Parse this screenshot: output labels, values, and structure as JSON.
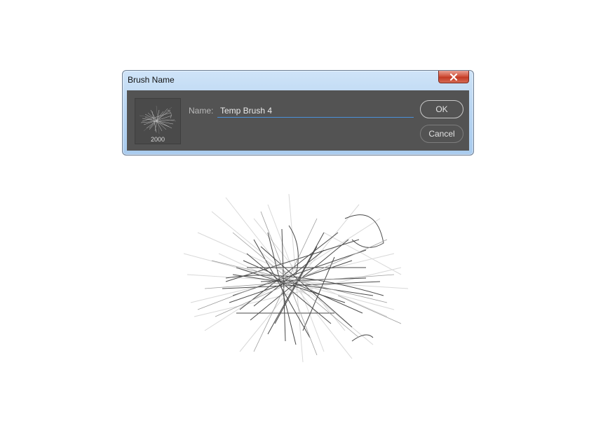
{
  "dialog": {
    "title": "Brush Name",
    "thumbnail_size": "2000",
    "name_label": "Name:",
    "name_value": "Temp Brush 4",
    "ok_label": "OK",
    "cancel_label": "Cancel"
  },
  "icons": {
    "close": "close-icon",
    "thumbnail": "brush-thumbnail"
  },
  "colors": {
    "panel": "#535353",
    "title_bar": "#bcd7f2",
    "close_button": "#c94a33",
    "input_underline": "#4a90d9"
  }
}
